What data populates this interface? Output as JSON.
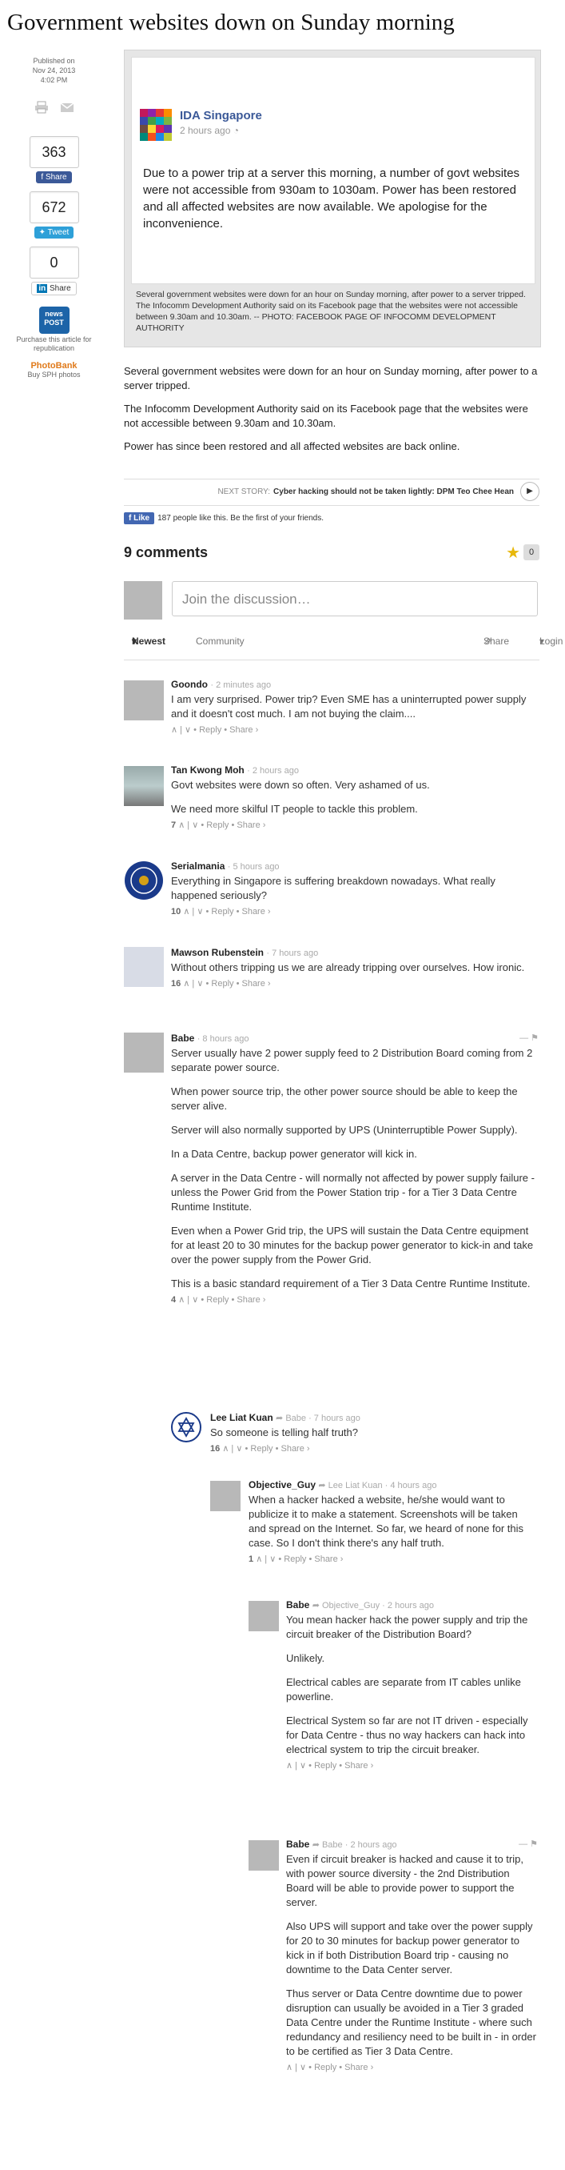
{
  "article": {
    "title": "Government websites down on Sunday morning",
    "published_label": "Published on",
    "published_date": "Nov 24, 2013",
    "published_time": "4:02 PM",
    "paragraphs": [
      "Several government websites were down for an hour on Sunday morning, after power to a server tripped.",
      "The Infocomm Development Authority said on its Facebook page that the websites were not accessible between 9.30am and 10.30am.",
      "Power has since been restored and all affected websites are back online."
    ]
  },
  "share": {
    "fb_count": "363",
    "fb_label": "Share",
    "tw_count": "672",
    "tw_label": "Tweet",
    "li_count": "0",
    "li_label": "Share",
    "newspost_label": "news POST",
    "purchase_text": "Purchase this article for republication",
    "photobank_label": "PhotoBank",
    "photobank_text": "Buy SPH photos"
  },
  "image": {
    "page_name": "IDA Singapore",
    "post_time": "2 hours ago",
    "post_text": "Due to a power trip at a server this morning, a number of govt websites were not accessible from 930am to 1030am. Power has been restored and all affected websites are now available. We apologise for the inconvenience.",
    "caption": "Several government websites were down for an hour on Sunday morning, after power to a server tripped. The Infocomm Development Authority said on its Facebook page that the websites were not accessible between 9.30am and 10.30am. -- PHOTO: FACEBOOK PAGE OF INFOCOMM DEVELOPMENT AUTHORITY"
  },
  "next_story": {
    "label": "NEXT STORY:",
    "title": "Cyber hacking should not be taken lightly: DPM Teo Chee Hean"
  },
  "fb_like": {
    "button": "Like",
    "text": "187 people like this. Be the first of your friends."
  },
  "comments_section": {
    "count_label": "9 comments",
    "star_count": "0",
    "compose_placeholder": "Join the discussion…",
    "tab_newest": "Newest",
    "tab_community": "Community",
    "share": "Share",
    "login": "Login"
  },
  "comments": [
    {
      "name": "Goondo",
      "time": "2 minutes ago",
      "paragraphs": [
        "I am very surprised. Power trip? Even SME has a uninterrupted power supply and it doesn't cost much. I am not buying the claim...."
      ],
      "votes": "",
      "reply": "Reply",
      "share": "Share ›"
    },
    {
      "name": "Tan Kwong Moh",
      "time": "2 hours ago",
      "paragraphs": [
        "Govt websites were down so often. Very ashamed of us.",
        "We need more skilful IT people to tackle this problem."
      ],
      "votes": "7",
      "reply": "Reply",
      "share": "Share ›"
    },
    {
      "name": "Serialmania",
      "time": "5 hours ago",
      "paragraphs": [
        "Everything in Singapore is suffering breakdown nowadays. What really happened seriously?"
      ],
      "votes": "10",
      "reply": "Reply",
      "share": "Share ›"
    },
    {
      "name": "Mawson Rubenstein",
      "time": "7 hours ago",
      "paragraphs": [
        "Without others tripping us we are already tripping over ourselves. How ironic."
      ],
      "votes": "16",
      "reply": "Reply",
      "share": "Share ›"
    },
    {
      "name": "Babe",
      "time": "8 hours ago",
      "paragraphs": [
        "Server usually have 2 power supply feed to 2 Distribution Board coming from 2 separate power source.",
        "When power source trip, the other power source should be able to keep the server alive.",
        "Server will also normally supported by UPS (Uninterruptible Power Supply).",
        "In a Data Centre, backup power generator will kick in.",
        "A server in the Data Centre - will normally not affected by power supply failure - unless the Power Grid from the Power Station trip - for a Tier 3 Data Centre Runtime Institute.",
        "Even when a Power Grid trip, the UPS will sustain the Data Centre equipment for at least 20 to 30 minutes for the backup power generator to kick-in and take over the power supply from the Power Grid.",
        "This is a basic standard requirement of a Tier 3 Data Centre Runtime Institute."
      ],
      "votes": "4",
      "reply": "Reply",
      "share": "Share ›"
    },
    {
      "name": "Lee Liat Kuan",
      "reply_to": "Babe",
      "time": "7 hours ago",
      "paragraphs": [
        "So someone is telling half truth?"
      ],
      "votes": "16",
      "reply": "Reply",
      "share": "Share ›"
    },
    {
      "name": "Objective_Guy",
      "reply_to": "Lee Liat Kuan",
      "time": "4 hours ago",
      "paragraphs": [
        "When a hacker hacked a website, he/she would want to publicize it to make a statement. Screenshots will be taken and spread on the Internet. So far, we heard of none for this case. So I don't think there's any half truth."
      ],
      "votes": "1",
      "reply": "Reply",
      "share": "Share ›"
    },
    {
      "name": "Babe",
      "reply_to": "Objective_Guy",
      "time": "2 hours ago",
      "paragraphs": [
        "You mean hacker hack the power supply and trip the circuit breaker of the Distribution Board?",
        "Unlikely.",
        "Electrical cables are separate from IT cables unlike powerline.",
        "Electrical System so far are not IT driven - especially for Data Centre - thus no way hackers can hack into electrical system to trip the circuit breaker."
      ],
      "votes": "",
      "reply": "Reply",
      "share": "Share ›"
    },
    {
      "name": "Babe",
      "reply_to": "Babe",
      "time": "2 hours ago",
      "paragraphs": [
        "Even if circuit breaker is hacked and cause it to trip, with power source diversity - the 2nd Distribution Board will be able to provide power to support the server.",
        "Also UPS will support and take over the power supply for 20 to 30 minutes for backup power generator to kick in if both Distribution Board trip - causing no downtime to the Data Center server.",
        "Thus server or Data Centre downtime due to power disruption can usually be avoided in a Tier 3 graded Data Centre under the Runtime Institute - where such redundancy and resiliency need to be built in - in order to be certified as Tier 3 Data Centre."
      ],
      "votes": "",
      "reply": "Reply",
      "share": "Share ›"
    }
  ]
}
